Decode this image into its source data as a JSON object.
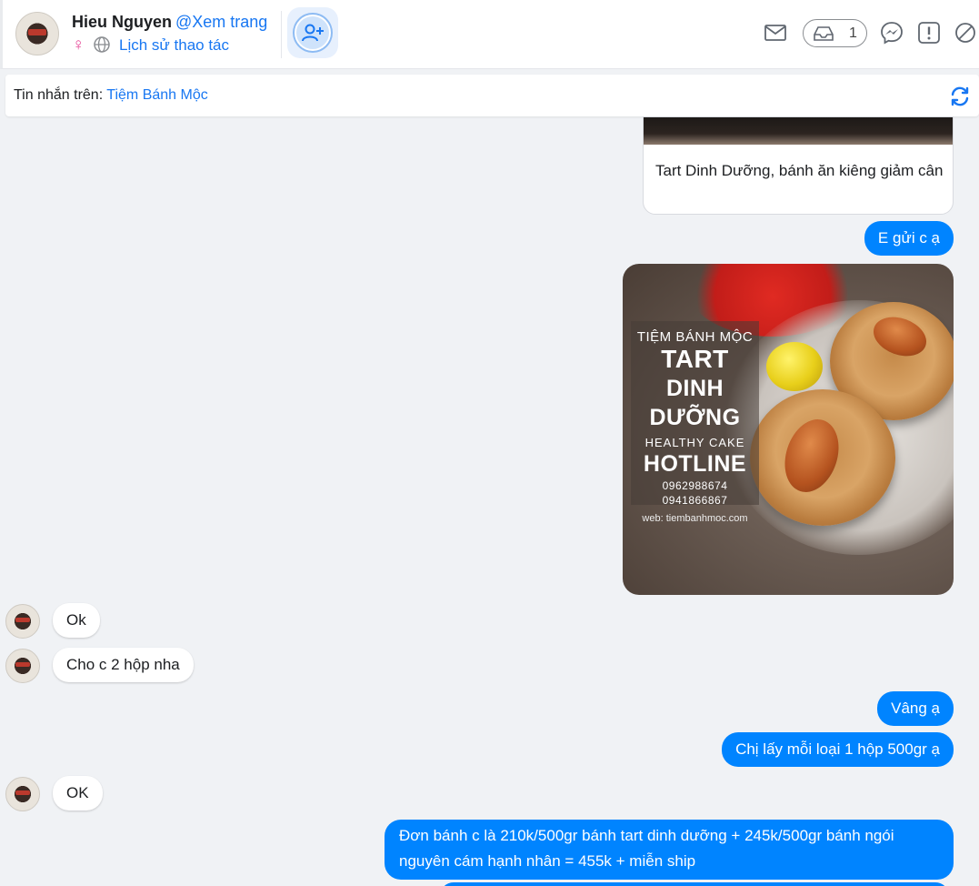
{
  "header": {
    "name": "Hieu Nguyen",
    "view_link": "@Xem trang",
    "gender_symbol": "♀",
    "history_link": "Lịch sử thao tác",
    "inbox_count": "1"
  },
  "subbar": {
    "label": "Tin nhắn trên:",
    "page_name": "Tiệm Bánh Mộc"
  },
  "messages": {
    "card_title": "Tart Dinh Dưỡng, bánh ăn kiêng giảm cân",
    "out_1": "E gửi c ạ",
    "photo": {
      "brand": "TIỆM BÁNH MỘC",
      "line1": "TART",
      "line2": "DINH DƯỠNG",
      "line3": "HEALTHY CAKE",
      "line4": "HOTLINE",
      "phone1": "0962988674",
      "phone2": "0941866867",
      "web": "web: tiembanhmoc.com"
    },
    "in_1": "Ok",
    "in_2": "Cho c 2 hộp nha",
    "out_2": "Vâng ạ",
    "out_3": "Chị lấy mỗi loại 1 hộp 500gr ạ",
    "in_3": "OK",
    "out_4_line1": "Đơn bánh c là 210k/500gr bánh tart dinh dưỡng + 245k/500gr bánh ngói",
    "out_4_line2": "nguyên cám hạnh nhân = 455k + miễn ship"
  },
  "colors": {
    "accent": "#1877f2",
    "bubble_out": "#0084ff",
    "background": "#f0f2f5"
  },
  "icons": [
    "add-contact-icon",
    "mail-icon",
    "inbox-icon",
    "messenger-icon",
    "report-icon",
    "block-icon",
    "refresh-icon",
    "globe-icon"
  ]
}
